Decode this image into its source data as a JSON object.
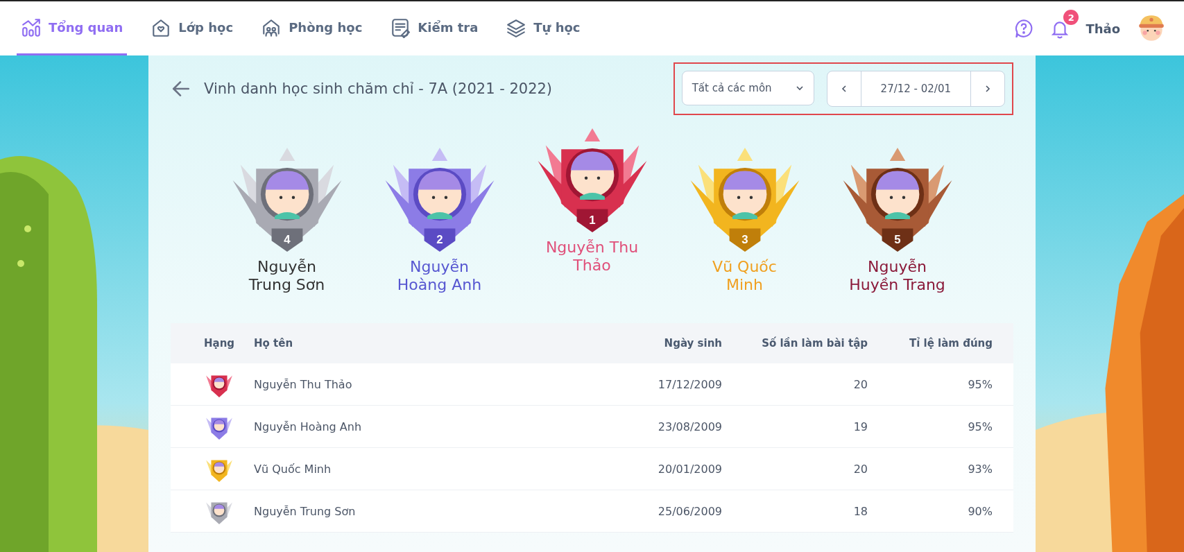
{
  "nav": {
    "tabs": [
      {
        "label": "Tổng quan",
        "kind": "chart",
        "selected": true
      },
      {
        "label": "Lớp học",
        "kind": "home",
        "selected": false
      },
      {
        "label": "Phòng học",
        "kind": "room",
        "selected": false
      },
      {
        "label": "Kiểm tra",
        "kind": "test",
        "selected": false
      },
      {
        "label": "Tự học",
        "kind": "layers",
        "selected": false
      }
    ],
    "notification_count": "2",
    "user_name": "Thảo"
  },
  "header": {
    "title": "Vinh danh học sinh chăm chỉ - 7A (2021 - 2022)",
    "subject_filter": "Tất cả các môn",
    "week_range": "27/12 - 02/01"
  },
  "podium": [
    {
      "rank": "4",
      "name": "Nguyễn Trung Sơn",
      "kind": "silver",
      "color": "#333333"
    },
    {
      "rank": "2",
      "name": "Nguyễn Hoàng Anh",
      "kind": "purple",
      "color": "#5757d1"
    },
    {
      "rank": "1",
      "name": "Nguyễn Thu Thảo",
      "kind": "red",
      "color": "#e0507a"
    },
    {
      "rank": "3",
      "name": "Vũ Quốc Minh",
      "kind": "gold",
      "color": "#f0a020"
    },
    {
      "rank": "5",
      "name": "Nguyễn Huyền Trang",
      "kind": "bronze",
      "color": "#8b1a3a"
    }
  ],
  "table": {
    "columns": [
      "Hạng",
      "Họ tên",
      "Ngày sinh",
      "Số lần làm bài tập",
      "Tỉ lệ làm đúng"
    ],
    "rows": [
      {
        "kind": "red",
        "name": "Nguyễn Thu Thảo",
        "birth_date": "17/12/2009",
        "exercise_count": "20",
        "correct_rate": "95%"
      },
      {
        "kind": "purple",
        "name": "Nguyễn Hoàng Anh",
        "birth_date": "23/08/2009",
        "exercise_count": "19",
        "correct_rate": "95%"
      },
      {
        "kind": "gold",
        "name": "Vũ Quốc Minh",
        "birth_date": "20/01/2009",
        "exercise_count": "20",
        "correct_rate": "93%"
      },
      {
        "kind": "silver",
        "name": "Nguyễn Trung Sơn",
        "birth_date": "25/06/2009",
        "exercise_count": "18",
        "correct_rate": "90%"
      }
    ]
  }
}
